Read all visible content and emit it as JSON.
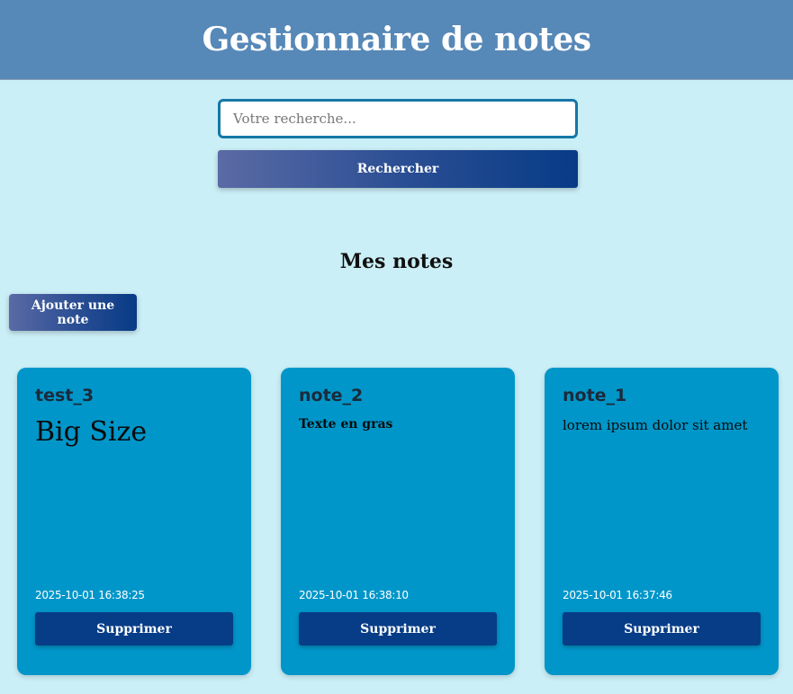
{
  "header": {
    "title": "Gestionnaire de notes"
  },
  "search": {
    "placeholder": "Votre recherche...",
    "value": "",
    "button_label": "Rechercher"
  },
  "notes_section": {
    "title": "Mes notes",
    "add_button_label": "Ajouter une note"
  },
  "notes": [
    {
      "title": "test_3",
      "content": "Big Size",
      "date": "2025-10-01 16:38:25",
      "delete_label": "Supprimer"
    },
    {
      "title": "note_2",
      "content": "Texte en gras",
      "date": "2025-10-01 16:38:10",
      "delete_label": "Supprimer"
    },
    {
      "title": "note_1",
      "content": "lorem ipsum dolor sit amet",
      "date": "2025-10-01 16:37:46",
      "delete_label": "Supprimer"
    }
  ],
  "colors": {
    "background": "#cbeff7",
    "header": "#5688b8",
    "card": "#0096c9",
    "button_dark": "#073d87",
    "input_border": "#1677a6"
  }
}
